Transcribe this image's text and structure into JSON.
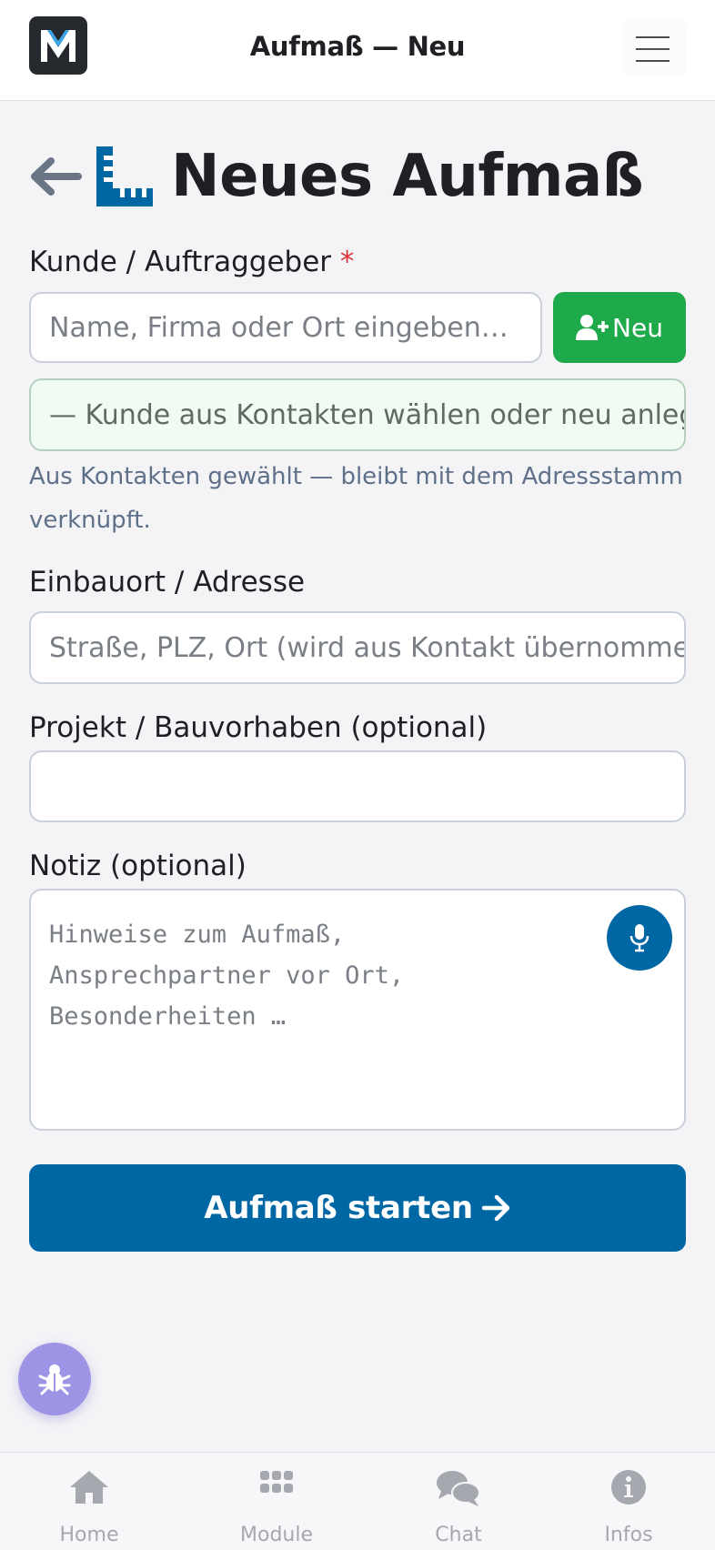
{
  "header": {
    "title": "Aufmaß — Neu",
    "logo_letter": "M"
  },
  "page": {
    "title": "Neues Aufmaß"
  },
  "form": {
    "customer": {
      "label": "Kunde / Auftraggeber",
      "required_marker": "*",
      "placeholder": "Name, Firma oder Ort eingeben…",
      "new_button_label": "Neu",
      "select_text": "— Kunde aus Kontakten wählen oder neu anlegen —",
      "hint": "Aus Kontakten gewählt — bleibt mit dem Adressstamm verknüpft."
    },
    "address": {
      "label": "Einbauort / Adresse",
      "placeholder": "Straße, PLZ, Ort (wird aus Kontakt übernommen)"
    },
    "project": {
      "label": "Projekt / Bauvorhaben (optional)",
      "value": ""
    },
    "note": {
      "label": "Notiz (optional)",
      "placeholder": "Hinweise zum Aufmaß, Ansprechpartner vor Ort, Besonderheiten …"
    },
    "submit_label": "Aufmaß starten"
  },
  "tabbar": {
    "items": [
      {
        "label": "Home",
        "icon": "home-icon"
      },
      {
        "label": "Module",
        "icon": "grid-icon"
      },
      {
        "label": "Chat",
        "icon": "chat-icon"
      },
      {
        "label": "Infos",
        "icon": "info-icon"
      }
    ]
  },
  "colors": {
    "primary": "#0067a5",
    "success": "#1ea94a",
    "required": "#d9323c",
    "bug_button": "#9e94e6"
  }
}
